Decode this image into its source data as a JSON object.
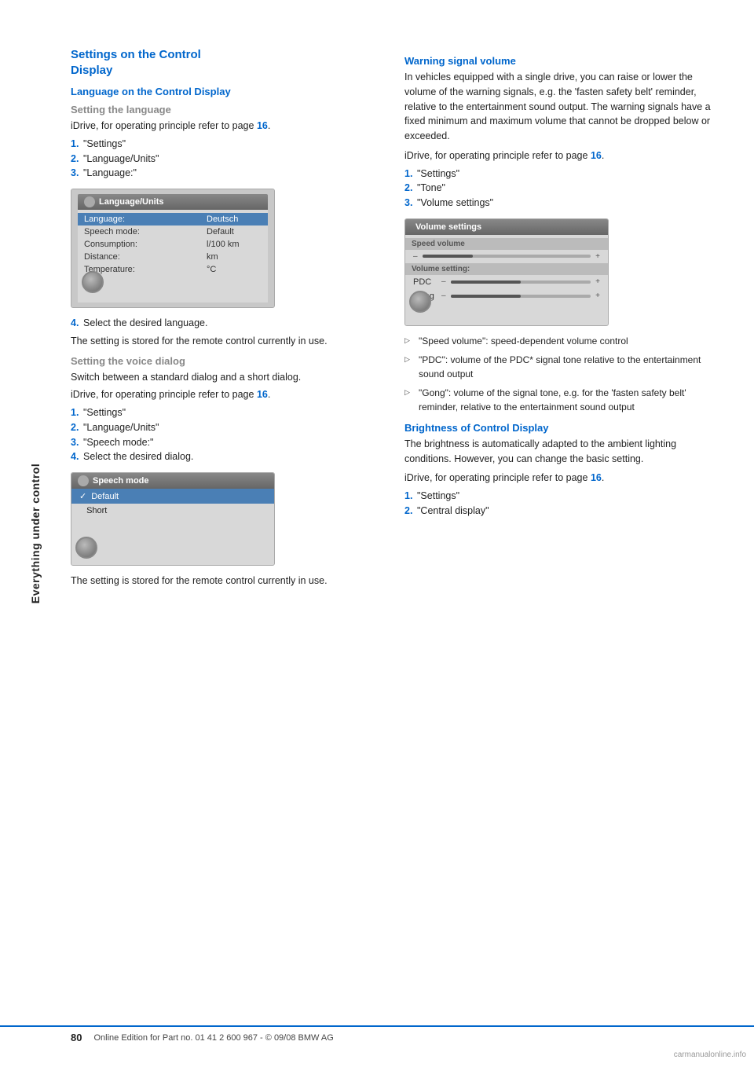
{
  "sidebar": {
    "label": "Everything under control"
  },
  "left_col": {
    "section_title_line1": "Settings on the Control",
    "section_title_line2": "Display",
    "subsection1_title": "Language on the Control Display",
    "subsubsection1_title": "Setting the language",
    "intro_text": "iDrive, for operating principle refer to page",
    "intro_link": "16",
    "steps1": [
      {
        "num": "1.",
        "text": "\"Settings\""
      },
      {
        "num": "2.",
        "text": "\"Language/Units\""
      },
      {
        "num": "3.",
        "text": "\"Language:\""
      }
    ],
    "lang_screenshot": {
      "header": "Language/Units",
      "rows": [
        {
          "label": "Language:",
          "value": "Deutsch",
          "highlighted": true
        },
        {
          "label": "Speech mode:",
          "value": "Default",
          "highlighted": false
        },
        {
          "label": "Consumption:",
          "value": "l/100 km",
          "highlighted": false
        },
        {
          "label": "Distance:",
          "value": "km",
          "highlighted": false
        },
        {
          "label": "Temperature:",
          "value": "°C",
          "highlighted": false
        }
      ]
    },
    "step4_text": "Select the desired language.",
    "note_text": "The setting is stored for the remote control currently in use.",
    "subsubsection2_title": "Setting the voice dialog",
    "voice_intro": "Switch between a standard dialog and a short dialog.",
    "voice_idrive_text": "iDrive, for operating principle refer to page",
    "voice_idrive_link": "16",
    "steps2": [
      {
        "num": "1.",
        "text": "\"Settings\""
      },
      {
        "num": "2.",
        "text": "\"Language/Units\""
      },
      {
        "num": "3.",
        "text": "\"Speech mode:\""
      },
      {
        "num": "4.",
        "text": "Select the desired dialog."
      }
    ],
    "speech_screenshot": {
      "header": "Speech mode",
      "rows": [
        {
          "label": "Default",
          "check": true,
          "highlighted": true
        },
        {
          "label": "Short",
          "check": false,
          "highlighted": false
        }
      ]
    },
    "note2_text": "The setting is stored for the remote control currently in use."
  },
  "right_col": {
    "warning_title": "Warning signal volume",
    "warning_para1": "In vehicles equipped with a single drive, you can raise or lower the volume of the warning signals, e.g. the 'fasten safety belt' reminder, relative to the entertainment sound output. The warning signals have a fixed minimum and maximum volume that cannot be dropped below or exceeded.",
    "warning_idrive_text": "iDrive, for operating principle refer to page",
    "warning_idrive_link": "16",
    "warning_steps": [
      {
        "num": "1.",
        "text": "\"Settings\""
      },
      {
        "num": "2.",
        "text": "\"Tone\""
      },
      {
        "num": "3.",
        "text": "\"Volume settings\""
      }
    ],
    "vol_screenshot": {
      "header": "Volume settings",
      "speed_volume_label": "Speed volume",
      "volume_setting_label": "Volume setting:",
      "rows": [
        {
          "label": "PDC",
          "fill_pct": 50
        },
        {
          "label": "Gong",
          "fill_pct": 50
        }
      ]
    },
    "bullets": [
      "\"Speed volume\": speed-dependent volume control",
      "\"PDC\": volume of the PDC* signal tone relative to the entertainment sound output",
      "\"Gong\": volume of the signal tone, e.g. for the 'fasten safety belt' reminder, relative to the entertainment sound output"
    ],
    "brightness_title": "Brightness of Control Display",
    "brightness_para": "The brightness is automatically adapted to the ambient lighting conditions. However, you can change the basic setting.",
    "brightness_idrive_text": "iDrive, for operating principle refer to page",
    "brightness_idrive_link": "16",
    "brightness_steps": [
      {
        "num": "1.",
        "text": "\"Settings\""
      },
      {
        "num": "2.",
        "text": "\"Central display\""
      }
    ]
  },
  "footer": {
    "page_num": "80",
    "text": "Online Edition for Part no. 01 41 2 600 967  -  © 09/08 BMW AG"
  },
  "watermark": "carmanualonline.info"
}
